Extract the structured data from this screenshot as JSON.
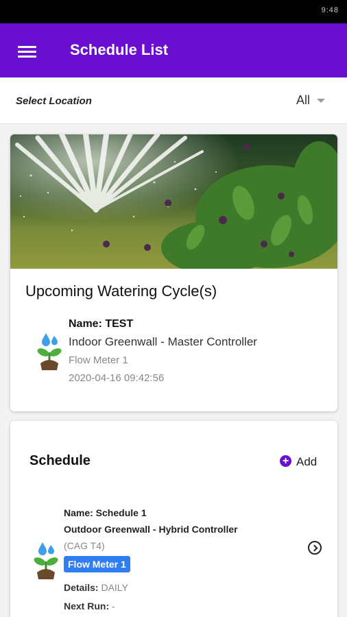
{
  "status_bar": {
    "right_text": "9:48"
  },
  "app_bar": {
    "title": "Schedule List",
    "menu_icon": "menu-icon"
  },
  "location": {
    "label": "Select Location",
    "selected": "All"
  },
  "upcoming": {
    "title": "Upcoming Watering Cycle(s)",
    "item": {
      "name": "Name: TEST",
      "controller": "Indoor Greenwall - Master Controller",
      "meter": "Flow Meter 1",
      "time": "2020-04-16 09:42:56"
    }
  },
  "schedule": {
    "title": "Schedule",
    "add_label": "Add",
    "items": [
      {
        "name": "Name: Schedule 1",
        "controller": "Outdoor Greenwall - Hybrid Controller",
        "group": "(CAG T4)",
        "meter_badge": "Flow Meter 1",
        "details_label": "Details:",
        "details_value": "DAILY",
        "next_label": "Next Run:",
        "next_value": "-"
      }
    ]
  },
  "colors": {
    "primary": "#6a0fd0",
    "badge": "#2f7ef3"
  }
}
